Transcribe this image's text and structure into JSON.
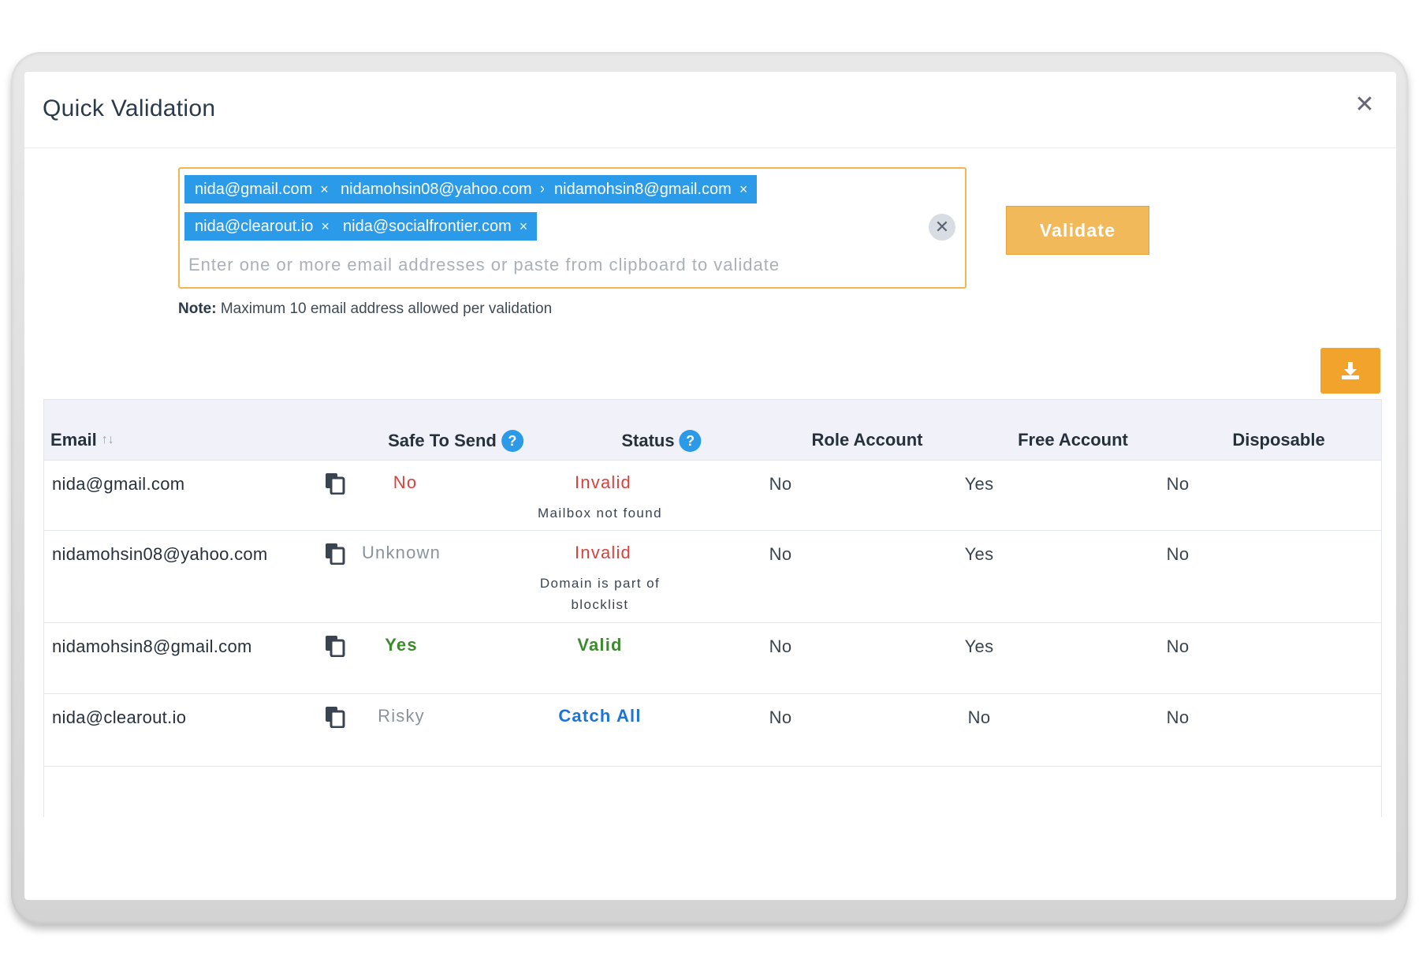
{
  "modal": {
    "title": "Quick Validation",
    "close_icon": "close-icon"
  },
  "input": {
    "tags": [
      "nida@gmail.com",
      "nidamohsin08@yahoo.com",
      "nidamohsin8@gmail.com",
      "nida@clearout.io",
      "nida@socialfrontier.com"
    ],
    "tag_remove_glyph": "×",
    "clear_all_glyph": "✕",
    "placeholder": "Enter one or more email addresses or paste from clipboard to validate",
    "value": ""
  },
  "validate_label": "Validate",
  "note": {
    "label": "Note:",
    "text": " Maximum 10 email address allowed per validation"
  },
  "download_icon": "download-icon",
  "table": {
    "headers": {
      "email": "Email",
      "safe_to_send": "Safe To Send",
      "status": "Status",
      "role_account": "Role Account",
      "free_account": "Free Account",
      "disposable": "Disposable"
    },
    "help_glyph": "?",
    "sort_glyph": "↑↓",
    "rows": [
      {
        "email": "nida@gmail.com",
        "safe": "No",
        "safe_color": "red",
        "status": "Invalid",
        "status_color": "red",
        "reason": "Mailbox not found",
        "role": "No",
        "free": "Yes",
        "disposable": "No"
      },
      {
        "email": "nidamohsin08@yahoo.com",
        "safe": "Unknown",
        "safe_color": "gray",
        "status": "Invalid",
        "status_color": "red",
        "reason": "Domain is part of blocklist",
        "role": "No",
        "free": "Yes",
        "disposable": "No"
      },
      {
        "email": "nidamohsin8@gmail.com",
        "safe": "Yes",
        "safe_color": "green",
        "status": "Valid",
        "status_color": "green",
        "reason": "",
        "role": "No",
        "free": "Yes",
        "disposable": "No"
      },
      {
        "email": "nida@clearout.io",
        "safe": "Risky",
        "safe_color": "gray",
        "status": "Catch All",
        "status_color": "blue",
        "reason": "",
        "role": "No",
        "free": "No",
        "disposable": "No"
      }
    ]
  },
  "colors": {
    "accent_orange": "#f2b95a",
    "tag_blue": "#2b9ae8",
    "invalid_red": "#d9413c",
    "valid_green": "#3c8a2e",
    "catch_all_blue": "#1c74d9"
  }
}
